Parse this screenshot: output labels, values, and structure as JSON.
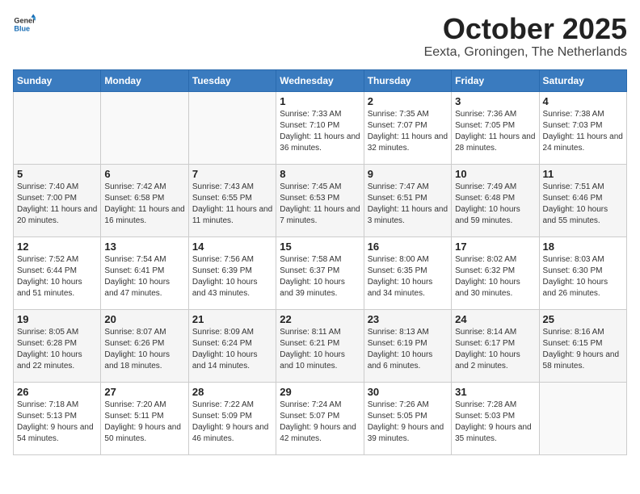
{
  "logo": {
    "text_general": "General",
    "text_blue": "Blue"
  },
  "header": {
    "month": "October 2025",
    "location": "Eexta, Groningen, The Netherlands"
  },
  "weekdays": [
    "Sunday",
    "Monday",
    "Tuesday",
    "Wednesday",
    "Thursday",
    "Friday",
    "Saturday"
  ],
  "weeks": [
    [
      {
        "day": "",
        "sunrise": "",
        "sunset": "",
        "daylight": ""
      },
      {
        "day": "",
        "sunrise": "",
        "sunset": "",
        "daylight": ""
      },
      {
        "day": "",
        "sunrise": "",
        "sunset": "",
        "daylight": ""
      },
      {
        "day": "1",
        "sunrise": "Sunrise: 7:33 AM",
        "sunset": "Sunset: 7:10 PM",
        "daylight": "Daylight: 11 hours and 36 minutes."
      },
      {
        "day": "2",
        "sunrise": "Sunrise: 7:35 AM",
        "sunset": "Sunset: 7:07 PM",
        "daylight": "Daylight: 11 hours and 32 minutes."
      },
      {
        "day": "3",
        "sunrise": "Sunrise: 7:36 AM",
        "sunset": "Sunset: 7:05 PM",
        "daylight": "Daylight: 11 hours and 28 minutes."
      },
      {
        "day": "4",
        "sunrise": "Sunrise: 7:38 AM",
        "sunset": "Sunset: 7:03 PM",
        "daylight": "Daylight: 11 hours and 24 minutes."
      }
    ],
    [
      {
        "day": "5",
        "sunrise": "Sunrise: 7:40 AM",
        "sunset": "Sunset: 7:00 PM",
        "daylight": "Daylight: 11 hours and 20 minutes."
      },
      {
        "day": "6",
        "sunrise": "Sunrise: 7:42 AM",
        "sunset": "Sunset: 6:58 PM",
        "daylight": "Daylight: 11 hours and 16 minutes."
      },
      {
        "day": "7",
        "sunrise": "Sunrise: 7:43 AM",
        "sunset": "Sunset: 6:55 PM",
        "daylight": "Daylight: 11 hours and 11 minutes."
      },
      {
        "day": "8",
        "sunrise": "Sunrise: 7:45 AM",
        "sunset": "Sunset: 6:53 PM",
        "daylight": "Daylight: 11 hours and 7 minutes."
      },
      {
        "day": "9",
        "sunrise": "Sunrise: 7:47 AM",
        "sunset": "Sunset: 6:51 PM",
        "daylight": "Daylight: 11 hours and 3 minutes."
      },
      {
        "day": "10",
        "sunrise": "Sunrise: 7:49 AM",
        "sunset": "Sunset: 6:48 PM",
        "daylight": "Daylight: 10 hours and 59 minutes."
      },
      {
        "day": "11",
        "sunrise": "Sunrise: 7:51 AM",
        "sunset": "Sunset: 6:46 PM",
        "daylight": "Daylight: 10 hours and 55 minutes."
      }
    ],
    [
      {
        "day": "12",
        "sunrise": "Sunrise: 7:52 AM",
        "sunset": "Sunset: 6:44 PM",
        "daylight": "Daylight: 10 hours and 51 minutes."
      },
      {
        "day": "13",
        "sunrise": "Sunrise: 7:54 AM",
        "sunset": "Sunset: 6:41 PM",
        "daylight": "Daylight: 10 hours and 47 minutes."
      },
      {
        "day": "14",
        "sunrise": "Sunrise: 7:56 AM",
        "sunset": "Sunset: 6:39 PM",
        "daylight": "Daylight: 10 hours and 43 minutes."
      },
      {
        "day": "15",
        "sunrise": "Sunrise: 7:58 AM",
        "sunset": "Sunset: 6:37 PM",
        "daylight": "Daylight: 10 hours and 39 minutes."
      },
      {
        "day": "16",
        "sunrise": "Sunrise: 8:00 AM",
        "sunset": "Sunset: 6:35 PM",
        "daylight": "Daylight: 10 hours and 34 minutes."
      },
      {
        "day": "17",
        "sunrise": "Sunrise: 8:02 AM",
        "sunset": "Sunset: 6:32 PM",
        "daylight": "Daylight: 10 hours and 30 minutes."
      },
      {
        "day": "18",
        "sunrise": "Sunrise: 8:03 AM",
        "sunset": "Sunset: 6:30 PM",
        "daylight": "Daylight: 10 hours and 26 minutes."
      }
    ],
    [
      {
        "day": "19",
        "sunrise": "Sunrise: 8:05 AM",
        "sunset": "Sunset: 6:28 PM",
        "daylight": "Daylight: 10 hours and 22 minutes."
      },
      {
        "day": "20",
        "sunrise": "Sunrise: 8:07 AM",
        "sunset": "Sunset: 6:26 PM",
        "daylight": "Daylight: 10 hours and 18 minutes."
      },
      {
        "day": "21",
        "sunrise": "Sunrise: 8:09 AM",
        "sunset": "Sunset: 6:24 PM",
        "daylight": "Daylight: 10 hours and 14 minutes."
      },
      {
        "day": "22",
        "sunrise": "Sunrise: 8:11 AM",
        "sunset": "Sunset: 6:21 PM",
        "daylight": "Daylight: 10 hours and 10 minutes."
      },
      {
        "day": "23",
        "sunrise": "Sunrise: 8:13 AM",
        "sunset": "Sunset: 6:19 PM",
        "daylight": "Daylight: 10 hours and 6 minutes."
      },
      {
        "day": "24",
        "sunrise": "Sunrise: 8:14 AM",
        "sunset": "Sunset: 6:17 PM",
        "daylight": "Daylight: 10 hours and 2 minutes."
      },
      {
        "day": "25",
        "sunrise": "Sunrise: 8:16 AM",
        "sunset": "Sunset: 6:15 PM",
        "daylight": "Daylight: 9 hours and 58 minutes."
      }
    ],
    [
      {
        "day": "26",
        "sunrise": "Sunrise: 7:18 AM",
        "sunset": "Sunset: 5:13 PM",
        "daylight": "Daylight: 9 hours and 54 minutes."
      },
      {
        "day": "27",
        "sunrise": "Sunrise: 7:20 AM",
        "sunset": "Sunset: 5:11 PM",
        "daylight": "Daylight: 9 hours and 50 minutes."
      },
      {
        "day": "28",
        "sunrise": "Sunrise: 7:22 AM",
        "sunset": "Sunset: 5:09 PM",
        "daylight": "Daylight: 9 hours and 46 minutes."
      },
      {
        "day": "29",
        "sunrise": "Sunrise: 7:24 AM",
        "sunset": "Sunset: 5:07 PM",
        "daylight": "Daylight: 9 hours and 42 minutes."
      },
      {
        "day": "30",
        "sunrise": "Sunrise: 7:26 AM",
        "sunset": "Sunset: 5:05 PM",
        "daylight": "Daylight: 9 hours and 39 minutes."
      },
      {
        "day": "31",
        "sunrise": "Sunrise: 7:28 AM",
        "sunset": "Sunset: 5:03 PM",
        "daylight": "Daylight: 9 hours and 35 minutes."
      },
      {
        "day": "",
        "sunrise": "",
        "sunset": "",
        "daylight": ""
      }
    ]
  ]
}
